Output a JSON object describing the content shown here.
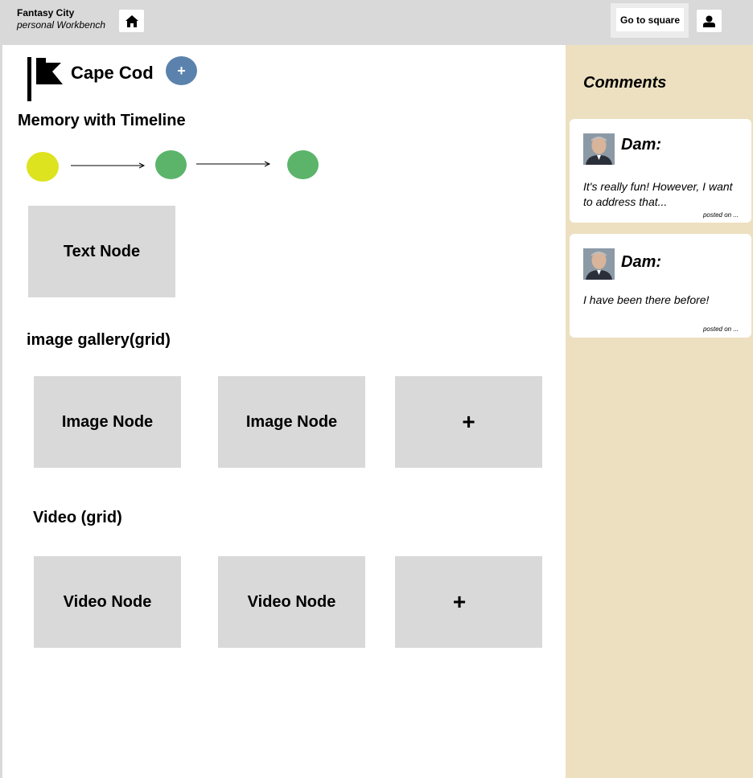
{
  "header": {
    "app_title": "Fantasy City",
    "app_subtitle": "personal Workbench",
    "home_icon": "home-icon",
    "square_label": "Go to square",
    "user_icon": "user-icon"
  },
  "page": {
    "flag_icon": "flag-icon",
    "title": "Cape Cod",
    "add_label": "+"
  },
  "timeline": {
    "title": "Memory with Timeline",
    "dots": [
      {
        "color": "#dde31f"
      },
      {
        "color": "#5bb46a"
      },
      {
        "color": "#5bb46a"
      }
    ],
    "text_node": "Text Node"
  },
  "gallery": {
    "title": "image gallery(grid)",
    "items": [
      "Image Node",
      "Image Node",
      "+"
    ]
  },
  "video": {
    "title": "Video (grid)",
    "items": [
      "Video Node",
      "Video Node",
      "+"
    ]
  },
  "sidebar": {
    "title": "Comments",
    "comments": [
      {
        "author": "Dam:",
        "text": "It's really fun! However, I want to address that...",
        "posted": "posted on ..."
      },
      {
        "author": "Dam:",
        "text": "I have been there before!",
        "posted": "posted on ..."
      }
    ]
  },
  "colors": {
    "header_bg": "#d9d9d9",
    "sidebar_bg": "#ede0c0",
    "accent_blue": "#5b82ad",
    "node_bg": "#d9d9d9"
  }
}
